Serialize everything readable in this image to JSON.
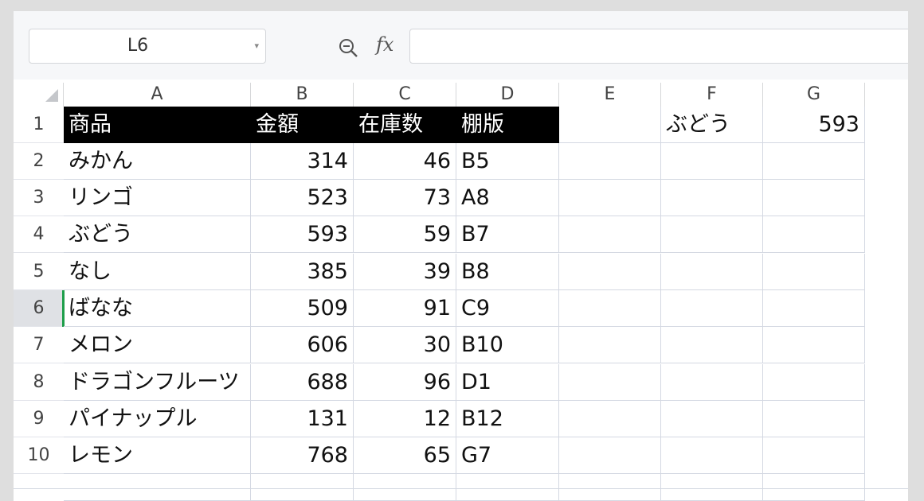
{
  "formula_bar": {
    "namebox_value": "L6",
    "namebox_dropdown_glyph": "▾",
    "zoom_icon": "zoom-icon",
    "fx_label": "fx",
    "formula_value": ""
  },
  "columns": [
    "A",
    "B",
    "C",
    "D",
    "E",
    "F",
    "G"
  ],
  "rows": [
    "1",
    "2",
    "3",
    "4",
    "5",
    "6",
    "7",
    "8",
    "9",
    "10"
  ],
  "active_row": "6",
  "table_header": [
    "商品",
    "金額",
    "在庫数",
    "棚版"
  ],
  "table_rows": [
    [
      "みかん",
      "314",
      "46",
      "B5"
    ],
    [
      "リンゴ",
      "523",
      "73",
      "A8"
    ],
    [
      "ぶどう",
      "593",
      "59",
      "B7"
    ],
    [
      "なし",
      "385",
      "39",
      "B8"
    ],
    [
      "ばなな",
      "509",
      "91",
      "C9"
    ],
    [
      "メロン",
      "606",
      "30",
      "B10"
    ],
    [
      "ドラゴンフルーツ",
      "688",
      "96",
      "D1"
    ],
    [
      "パイナップル",
      "131",
      "12",
      "B12"
    ],
    [
      "レモン",
      "768",
      "65",
      "G7"
    ]
  ],
  "lookup": {
    "F1": "ぶどう",
    "G1": "593"
  },
  "colors": {
    "header_bg": "#000000",
    "header_text": "#ffffff",
    "active_marker": "#1e9e4a"
  }
}
